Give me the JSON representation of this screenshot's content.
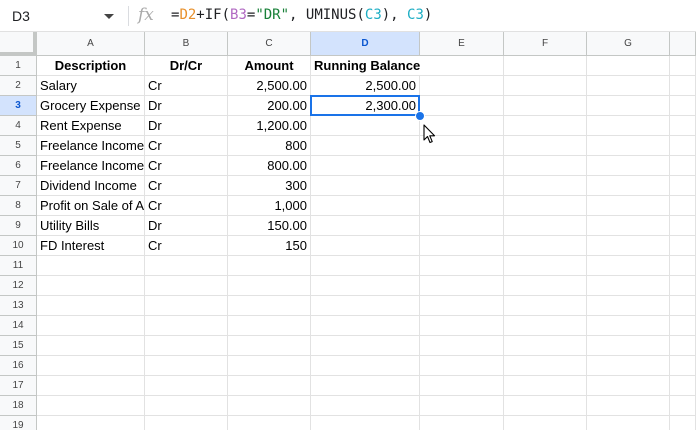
{
  "name_box": {
    "ref": "D3"
  },
  "formula": {
    "parts": [
      "=",
      "D2",
      "+IF(",
      "B3",
      "=",
      "\"DR\"",
      ", UMINUS(",
      "C3",
      "), ",
      "C3",
      ")"
    ]
  },
  "icons": {
    "fx": "fx",
    "dropdown": "chevron-down-icon",
    "cursor": "arrow-pointer-icon"
  },
  "colors": {
    "selection": "#1a73e8",
    "header_selected": "#d3e3fd"
  },
  "columns": [
    "A",
    "B",
    "C",
    "D",
    "E",
    "F",
    "G"
  ],
  "rows": [
    "1",
    "2",
    "3",
    "4",
    "5",
    "6",
    "7",
    "8",
    "9",
    "10",
    "11",
    "12",
    "13",
    "14",
    "15",
    "16",
    "17",
    "18",
    "19"
  ],
  "selected_cell": {
    "column": "D",
    "row": "3"
  },
  "table": {
    "headers": [
      "Description",
      "Dr/Cr",
      "Amount",
      "Running Balance"
    ],
    "rows": [
      [
        "Salary",
        "Cr",
        "2,500.00",
        "2,500.00"
      ],
      [
        "Grocery Expense",
        "Dr",
        "200.00",
        "2,300.00"
      ],
      [
        "Rent Expense",
        "Dr",
        "1,200.00",
        ""
      ],
      [
        "Freelance Income",
        "Cr",
        "800",
        ""
      ],
      [
        "Freelance Income",
        "Cr",
        "800.00",
        ""
      ],
      [
        "Dividend Income",
        "Cr",
        "300",
        ""
      ],
      [
        "Profit on Sale of As",
        "Cr",
        "1,000",
        ""
      ],
      [
        "Utility Bills",
        "Dr",
        "150.00",
        ""
      ],
      [
        "FD Interest",
        "Cr",
        "150",
        ""
      ]
    ]
  }
}
